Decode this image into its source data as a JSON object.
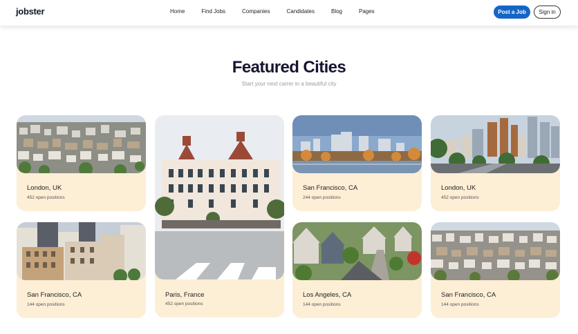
{
  "brand": {
    "logo_text": "jobster"
  },
  "nav": {
    "items": [
      "Home",
      "Find Jobs",
      "Companies",
      "Candidates",
      "Blog",
      "Pages"
    ],
    "post_label": "Post a Job",
    "sign_label": "Sign in"
  },
  "section": {
    "title": "Featured Cities",
    "subtitle": "Start your next carrer in a beautiful city"
  },
  "cities": [
    {
      "name": "London, UK",
      "count": "452 open positions"
    },
    {
      "name": "Paris, France",
      "count": "452 open positions"
    },
    {
      "name": "San Francisco, CA",
      "count": "244 open positions"
    },
    {
      "name": "London, UK",
      "count": "452 open positions"
    },
    {
      "name": "San Francisco, CA",
      "count": "144 open positions"
    },
    {
      "name": "Los Angeles, CA",
      "count": "144 open positions"
    },
    {
      "name": "San Francisco, CA",
      "count": "144 open positions"
    }
  ],
  "colors": {
    "accent": "#1466c6",
    "card_bg": "#fdeed6",
    "title": "#161630"
  }
}
